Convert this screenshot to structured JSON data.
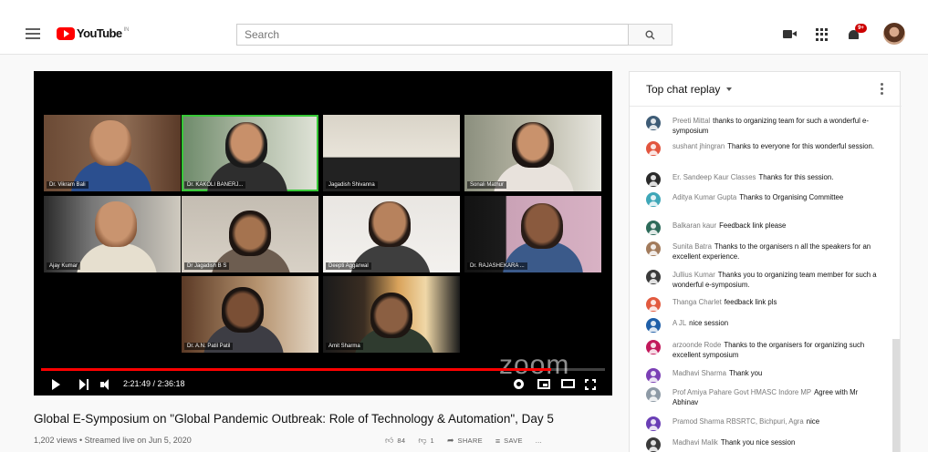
{
  "header": {
    "logo_text": "YouTube",
    "logo_sup": "IN",
    "search_placeholder": "Search",
    "notification_count": "9+"
  },
  "player": {
    "participants": [
      {
        "name": "Dr. Vikram Bali"
      },
      {
        "name": "Dr. KAKOLI BANERJ..."
      },
      {
        "name": "Jagadish Shivanna"
      },
      {
        "name": "Sonali Mathur"
      },
      {
        "name": "Ajay Kumar"
      },
      {
        "name": "Dr Jagadish B S"
      },
      {
        "name": "Deepti Aggarwal"
      },
      {
        "name": "Dr. RAJASHEKARA ..."
      },
      {
        "name": "Dr. A.N. Patil Patil"
      },
      {
        "name": "Amit Sharma"
      }
    ],
    "watermark": "zoom",
    "time": "2:21:49 / 2:36:18",
    "progress_fraction": 0.905
  },
  "video": {
    "title": "Global E-Symposium on \"Global Pandemic Outbreak: Role of Technology & Automation\", Day 5",
    "meta": "1,202 views • Streamed live on Jun 5, 2020",
    "likes": "84",
    "dislikes": "1",
    "share_label": "SHARE",
    "save_label": "SAVE",
    "more_label": "..."
  },
  "chat": {
    "title": "Top chat replay",
    "messages": [
      {
        "author": "Preeti Mittal",
        "text": "thanks to organizing team for such a wonderful e-symposium",
        "color": "#3e5c76"
      },
      {
        "author": "sushant jhingran",
        "text": "Thanks to everyone for this wonderful session.",
        "color": "#e2553f"
      },
      {
        "author": "Er. Sandeep Kaur Classes",
        "text": "Thanks for this session.",
        "color": "#2a2a2a"
      },
      {
        "author": "Aditya Kumar Gupta",
        "text": "Thanks to Organising Committee",
        "color": "#3fa7b8"
      },
      {
        "author": "Balkaran kaur",
        "text": "Feedback link please",
        "color": "#2d6b5a"
      },
      {
        "author": "Sunita Batra",
        "text": "Thanks to the organisers n all the speakers for an excellent experience.",
        "color": "#a27b5c"
      },
      {
        "author": "Jullius Kumar",
        "text": "Thanks you to organizing team member for such a wonderful e-symposium.",
        "color": "#3b3b3b"
      },
      {
        "author": "Thanga Charlet",
        "text": "feedback link pls",
        "color": "#e25a3f"
      },
      {
        "author": "A JL",
        "text": "nice session",
        "color": "#1f5fa8"
      },
      {
        "author": "arzoonde Rode",
        "text": "Thanks to the organisers for organizing such excellent symposium",
        "color": "#c2185b"
      },
      {
        "author": "Madhavi Sharma",
        "text": "Thank you",
        "color": "#7b3fb5"
      },
      {
        "author": "Prof Amiya Pahare Govt HMASC Indore MP",
        "text": "Agree with Mr Abhinav",
        "color": "#8e9aa6"
      },
      {
        "author": "Pramod Sharma RBSRTC, Bichpuri, Agra",
        "text": "nice",
        "color": "#6a3fb5"
      },
      {
        "author": "Madhavi Malik",
        "text": "Thank you nice session",
        "color": "#3a3a3a"
      }
    ]
  }
}
